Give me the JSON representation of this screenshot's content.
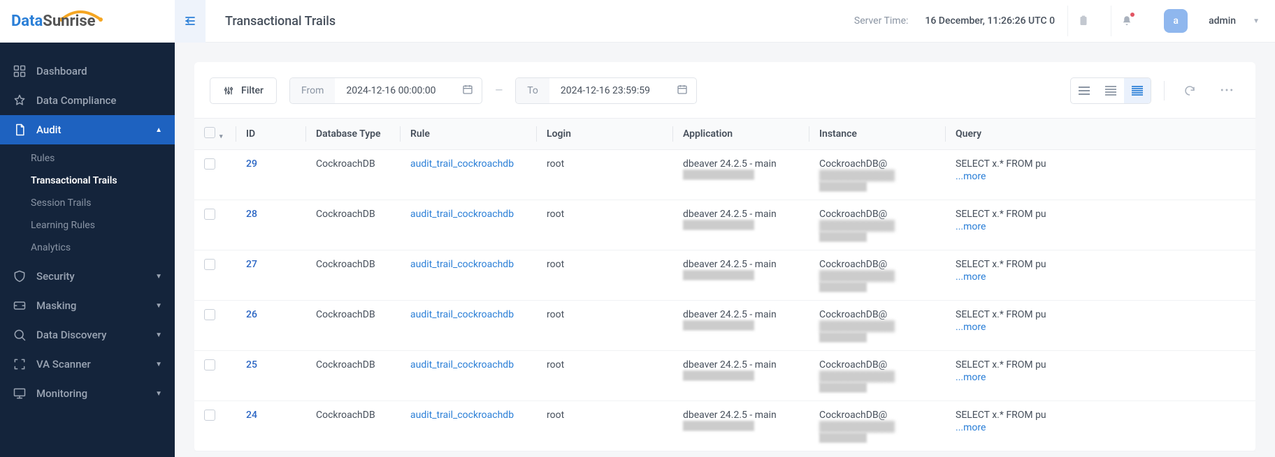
{
  "brand": {
    "part1": "Data",
    "part2": "Sunrise"
  },
  "header": {
    "title": "Transactional Trails",
    "server_time_label": "Server Time:",
    "server_time_value": "16 December, 11:26:26  UTC 0",
    "avatar_letter": "a",
    "username": "admin"
  },
  "sidebar": {
    "items": [
      {
        "label": "Dashboard",
        "icon": "dashboard"
      },
      {
        "label": "Data Compliance",
        "icon": "star"
      },
      {
        "label": "Audit",
        "icon": "file",
        "active": true
      },
      {
        "label": "Security",
        "icon": "shield",
        "caret": true
      },
      {
        "label": "Masking",
        "icon": "mask",
        "caret": true
      },
      {
        "label": "Data Discovery",
        "icon": "search",
        "caret": true
      },
      {
        "label": "VA Scanner",
        "icon": "scan",
        "caret": true
      },
      {
        "label": "Monitoring",
        "icon": "monitor",
        "caret": true
      }
    ],
    "audit_sub": [
      {
        "label": "Rules"
      },
      {
        "label": "Transactional Trails",
        "current": true
      },
      {
        "label": "Session Trails"
      },
      {
        "label": "Learning Rules"
      },
      {
        "label": "Analytics"
      }
    ]
  },
  "toolbar": {
    "filter_label": "Filter",
    "from_label": "From",
    "from_value": "2024-12-16 00:00:00",
    "to_label": "To",
    "to_value": "2024-12-16 23:59:59"
  },
  "table": {
    "columns": [
      "ID",
      "Database Type",
      "Rule",
      "Login",
      "Application",
      "Instance",
      "Query"
    ],
    "more_label": "...more",
    "rows": [
      {
        "id": "29",
        "db": "CockroachDB",
        "rule": "audit_trail_cockroachdb",
        "login": "root",
        "app": "dbeaver 24.2.5 - main",
        "inst_prefix": "CockroachDB@",
        "query": "SELECT x.* FROM pu"
      },
      {
        "id": "28",
        "db": "CockroachDB",
        "rule": "audit_trail_cockroachdb",
        "login": "root",
        "app": "dbeaver 24.2.5 - main",
        "inst_prefix": "CockroachDB@",
        "query": "SELECT x.* FROM pu"
      },
      {
        "id": "27",
        "db": "CockroachDB",
        "rule": "audit_trail_cockroachdb",
        "login": "root",
        "app": "dbeaver 24.2.5 - main",
        "inst_prefix": "CockroachDB@",
        "query": "SELECT x.* FROM pu"
      },
      {
        "id": "26",
        "db": "CockroachDB",
        "rule": "audit_trail_cockroachdb",
        "login": "root",
        "app": "dbeaver 24.2.5 - main",
        "inst_prefix": "CockroachDB@",
        "query": "SELECT x.* FROM pu"
      },
      {
        "id": "25",
        "db": "CockroachDB",
        "rule": "audit_trail_cockroachdb",
        "login": "root",
        "app": "dbeaver 24.2.5 - main",
        "inst_prefix": "CockroachDB@",
        "query": "SELECT x.* FROM pu"
      },
      {
        "id": "24",
        "db": "CockroachDB",
        "rule": "audit_trail_cockroachdb",
        "login": "root",
        "app": "dbeaver 24.2.5 - main",
        "inst_prefix": "CockroachDB@",
        "query": "SELECT x.* FROM pu"
      }
    ]
  }
}
